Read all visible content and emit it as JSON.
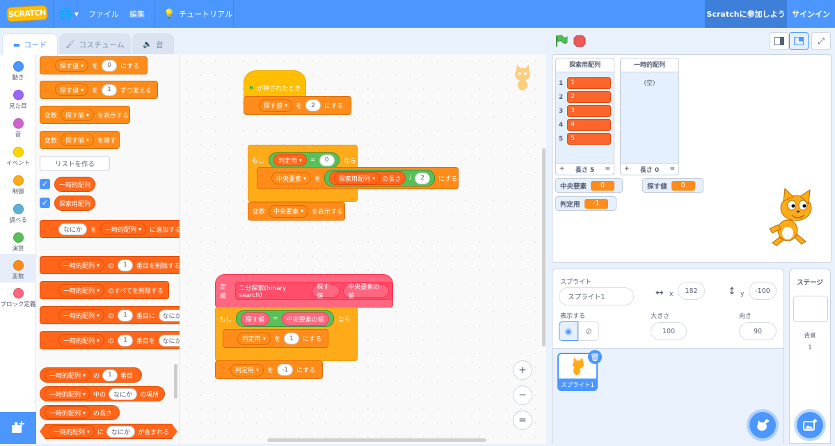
{
  "menubar": {
    "logo": "SCRATCH",
    "file": "ファイル",
    "edit": "編集",
    "tutorials": "チュートリアル",
    "join": "Scratchに参加しよう",
    "signin": "サインイン"
  },
  "tabs": {
    "code": "コード",
    "costumes": "コスチューム",
    "sounds": "音"
  },
  "categories": [
    {
      "label": "動き",
      "color": "#4c97ff"
    },
    {
      "label": "見た目",
      "color": "#9966ff"
    },
    {
      "label": "音",
      "color": "#cf63cf"
    },
    {
      "label": "イベント",
      "color": "#ffd500"
    },
    {
      "label": "制御",
      "color": "#ffab19"
    },
    {
      "label": "調べる",
      "color": "#5cb1d6"
    },
    {
      "label": "演算",
      "color": "#59c059"
    },
    {
      "label": "変数",
      "color": "#ff8c1a"
    },
    {
      "label": "ブロック定義",
      "color": "#ff6680"
    }
  ],
  "palette": {
    "set_var": "探す値",
    "set_to": "を",
    "set_val": "0",
    "set_suffix": "にする",
    "change_var": "探す値",
    "change_by": "を",
    "change_val": "1",
    "change_suffix": "ずつ変える",
    "show_prefix": "変数",
    "show_var": "探す値",
    "show_suffix": "を表示する",
    "hide_prefix": "変数",
    "hide_var": "探す値",
    "hide_suffix": "を隠す",
    "make_list": "リストを作る",
    "list1": "一時的配列",
    "list2": "探索用配列",
    "add_item": "なにか",
    "add_to": "を",
    "add_list": "一時的配列",
    "add_suffix": "に追加する",
    "del_list": "一時的配列",
    "del_of": "の",
    "del_val": "1",
    "del_suffix": "番目を削除する",
    "delall_list": "一時的配列",
    "delall_suffix": "のすべてを削除する",
    "ins_list": "一時的配列",
    "ins_of": "の",
    "ins_val": "1",
    "ins_suffix": "番目に",
    "ins_item": "なにか",
    "rep_list": "一時的配列",
    "rep_of": "の",
    "rep_val": "1",
    "rep_suffix": "番目を",
    "rep_item": "なにか",
    "item_list": "一時的配列",
    "item_of": "の",
    "item_val": "1",
    "item_suffix": "番目",
    "idx_list": "一時的配列",
    "idx_of": "中の",
    "idx_item": "なにか",
    "idx_suffix": "の場所",
    "len_list": "一時的配列",
    "len_suffix": "の長さ",
    "cont_list": "一時的配列",
    "cont_of": "に",
    "cont_item": "なにか",
    "cont_suffix": "が含まれる"
  },
  "script1": {
    "hat": "が押されたとき",
    "set_var": "探す値",
    "set_to": "を",
    "set_val": "2",
    "set_suffix": "にする"
  },
  "script2": {
    "if": "もし",
    "then": "なら",
    "cond_var": "判定用",
    "cond_eq": "=",
    "cond_val": "0",
    "set_var": "中央要素",
    "set_to": "を",
    "len_list": "探索用配列",
    "len_suffix": "の長さ",
    "div": "/",
    "div_val": "2",
    "set_suffix": "にする",
    "show_prefix": "変数",
    "show_var": "中央要素",
    "show_suffix": "を表示する"
  },
  "script3": {
    "define": "定義",
    "name": "二分探索(binary search)",
    "arg1": "探す値",
    "arg2": "中央要素の値",
    "if": "もし",
    "then": "なら",
    "cond_left": "探す値",
    "cond_eq": "=",
    "cond_right": "中央要素の値",
    "set1_var": "判定用",
    "set1_to": "を",
    "set1_val": "1",
    "set1_suffix": "にする",
    "set2_var": "判定用",
    "set2_to": "を",
    "set2_val": "-1",
    "set2_suffix": "にする"
  },
  "zoom": {
    "in": "+",
    "out": "−",
    "reset": "="
  },
  "monitors": {
    "list1": {
      "title": "探索用配列",
      "items": [
        {
          "index": "1",
          "value": "1"
        },
        {
          "index": "2",
          "value": "2"
        },
        {
          "index": "3",
          "value": "3"
        },
        {
          "index": "4",
          "value": "4"
        },
        {
          "index": "5",
          "value": "5"
        }
      ],
      "add": "+",
      "length": "長さ 5",
      "eq": "="
    },
    "list2": {
      "title": "一時的配列",
      "empty": "(空)",
      "add": "+",
      "length": "長さ 0",
      "eq": "="
    },
    "vars": [
      {
        "name": "中央要素",
        "value": "0"
      },
      {
        "name": "探す値",
        "value": "0"
      },
      {
        "name": "判定用",
        "value": "-1"
      }
    ]
  },
  "sprite_info": {
    "sprite_label": "スプライト",
    "sprite_name": "スプライト1",
    "x_label": "x",
    "x_value": "182",
    "y_label": "y",
    "y_value": "-100",
    "show_label": "表示する",
    "size_label": "大きさ",
    "size_value": "100",
    "direction_label": "向き",
    "direction_value": "90",
    "thumb_label": "スプライト1"
  },
  "stage_pane": {
    "title": "ステージ",
    "backdrops_label": "背景",
    "backdrops_count": "1"
  }
}
